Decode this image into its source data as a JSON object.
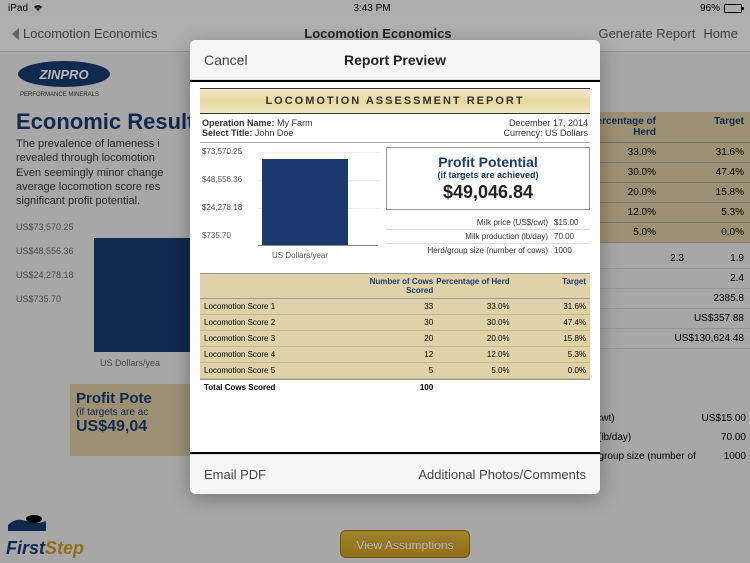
{
  "statusbar": {
    "device": "iPad",
    "time": "3:43 PM",
    "battery_pct": "96%"
  },
  "nav": {
    "back": "Locomotion Economics",
    "title": "Locomotion Economics",
    "generate": "Generate Report",
    "home": "Home"
  },
  "bg": {
    "brand": "ZINPRO",
    "brand_tag": "PERFORMANCE MINERALS",
    "heading": "Economic Result",
    "para1": "The prevalence of lameness i",
    "para2": "revealed through locomotion",
    "para3": "Even seemingly minor change",
    "para4": "average locomotion score res",
    "para5": "significant profit potential.",
    "axis": [
      "US$73,570.25",
      "US$48,556.36",
      "US$24,278.18",
      "US$735.70"
    ],
    "xlabel": "US Dollars/yea",
    "profit_title": "Profit Pote",
    "profit_sub": "(if targets are ac",
    "profit_val": "US$49,04",
    "view_assumptions": "View Assumptions",
    "firststep_a": "First",
    "firststep_b": "Step",
    "table_header": {
      "c1": "Percentage of Herd",
      "c2": "Target"
    },
    "table_rows": [
      {
        "p": "33.0%",
        "t": "31.6%"
      },
      {
        "p": "30.0%",
        "t": "47.4%"
      },
      {
        "p": "20.0%",
        "t": "15.8%"
      },
      {
        "p": "12.0%",
        "t": "5.3%"
      },
      {
        "p": "5.0%",
        "t": "0.0%"
      }
    ],
    "table2_rows": [
      {
        "l": "",
        "a": "2.3",
        "b": "1.9"
      },
      {
        "l": "",
        "a": "2.4",
        "b": ""
      },
      {
        "l": "",
        "a": "2385.8",
        "b": ""
      },
      {
        "l": "",
        "a": "US$357.88",
        "b": ""
      },
      {
        "l": "",
        "a": "US$130,624.48",
        "b": ""
      }
    ],
    "metrics_rows": [
      {
        "l": "US$/cwt)",
        "v": "US$15.00"
      },
      {
        "l": "ction (lb/day)",
        "v": "70.00"
      },
      {
        "l": "Herd/group size (number of cows)",
        "v": "1000"
      }
    ]
  },
  "modal": {
    "cancel": "Cancel",
    "title": "Report Preview",
    "email_pdf": "Email PDF",
    "additional": "Additional Photos/Comments"
  },
  "report": {
    "title": "LOCOMOTION ASSESSMENT REPORT",
    "op_name_label": "Operation Name:",
    "op_name": "My Farm",
    "select_title_label": "Select Title:",
    "select_title": "John Doe",
    "date": "December 17, 2014",
    "currency_label": "Currency:",
    "currency": "US Dollars",
    "chart_axis": [
      "$73,570.25",
      "$48,556.36",
      "$24,278.18",
      "$735.70"
    ],
    "chart_xlabel": "US Dollars/year",
    "profit_title": "Profit Potential",
    "profit_sub": "(if targets are achieved)",
    "profit_val": "$49,046.84",
    "metrics": [
      {
        "label": "Milk price (US$/cwt)",
        "val": "$15.00"
      },
      {
        "label": "Milk production (lb/day)",
        "val": "70.00"
      },
      {
        "label": "Herd/group size (number of cows)",
        "val": "1000"
      }
    ],
    "table_header": {
      "c1": "",
      "c2": "Number of Cows Scored",
      "c3": "Percentage of Herd",
      "c4": "Target"
    },
    "table_rows": [
      {
        "label": "Locomotion Score 1",
        "n": "33",
        "p": "33.0%",
        "t": "31.6%"
      },
      {
        "label": "Locomotion Score 2",
        "n": "30",
        "p": "30.0%",
        "t": "47.4%"
      },
      {
        "label": "Locomotion Score 3",
        "n": "20",
        "p": "20.0%",
        "t": "15.8%"
      },
      {
        "label": "Locomotion Score 4",
        "n": "12",
        "p": "12.0%",
        "t": "5.3%"
      },
      {
        "label": "Locomotion Score 5",
        "n": "5",
        "p": "5.0%",
        "t": "0.0%"
      }
    ],
    "total_label": "Total Cows Scored",
    "total_val": "100"
  },
  "chart_data": {
    "type": "bar",
    "title": "Profit Potential",
    "categories": [
      "US Dollars/year"
    ],
    "values": [
      49046.84
    ],
    "ylabel": "US Dollars/year",
    "ylim": [
      735.7,
      73570.25
    ],
    "yticks": [
      735.7,
      24278.18,
      48556.36,
      73570.25
    ]
  }
}
